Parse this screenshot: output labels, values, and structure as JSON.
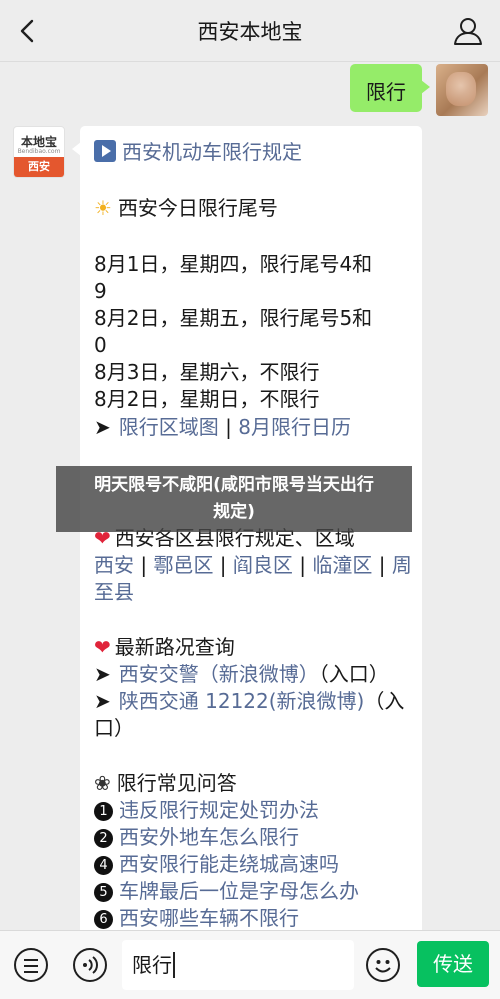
{
  "header": {
    "title": "西安本地宝",
    "back_icon": "chevron-left-icon",
    "profile_icon": "person-icon"
  },
  "user_message": {
    "text": "限行"
  },
  "bot_avatar": {
    "name": "本地宝",
    "url": "Bendibao.com",
    "city": "西安"
  },
  "bot_message": {
    "rule_link": "西安机动车限行规定",
    "today_heading": "西安今日限行尾号",
    "dates": [
      "8月1日，星期四，限行尾号4和",
      "9",
      "8月2日，星期五，限行尾号5和",
      "0",
      "8月3日，星期六，不限行",
      "8月2日，星期日，不限行"
    ],
    "map_link": "限行区域图",
    "calendar_link": "8月限行日历",
    "district_heading": "西安各区县限行规定、区域",
    "districts": [
      "西安",
      "鄠邑区",
      "阎良区",
      "临潼区",
      "周",
      "至县"
    ],
    "traffic_heading": "最新路况查询",
    "traffic_links": [
      {
        "label": "西安交警（新浪微博）",
        "suffix": "（入口）"
      },
      {
        "label": "陕西交通 12122(新浪微博)",
        "suffix": "（入",
        "suffix2": "口）"
      }
    ],
    "faq_heading": "限行常见问答",
    "faq": [
      {
        "num": "1",
        "label": "违反限行规定处罚办法"
      },
      {
        "num": "2",
        "label": "西安外地车怎么限行"
      },
      {
        "num": "4",
        "label": "西安限行能走绕城高速吗"
      },
      {
        "num": "5",
        "label": "车牌最后一位是字母怎么办"
      },
      {
        "num": "6",
        "label": "西安哪些车辆不限行"
      }
    ]
  },
  "overlay": {
    "line1": "明天限号不咸阳(咸阳市限号当天出行",
    "line2": "规定)"
  },
  "input_bar": {
    "value": "限行",
    "send_label": "传送"
  },
  "colors": {
    "send": "#07c160",
    "user_bubble": "#95ec69",
    "link": "#576b95"
  }
}
